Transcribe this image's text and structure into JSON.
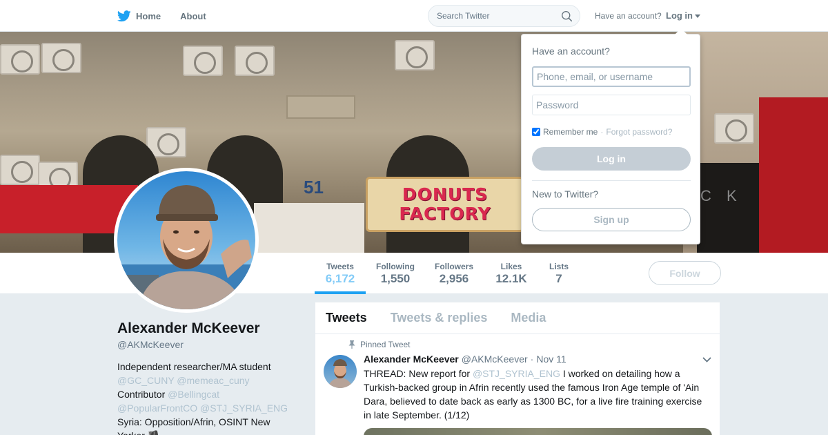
{
  "nav": {
    "home_label": "Home",
    "about_label": "About",
    "search_placeholder": "Search Twitter",
    "have_account": "Have an account?",
    "login_label": "Log in",
    "brand_color": "#1da1f2"
  },
  "banner": {
    "sign_donuts": "DONUTS",
    "sign_factory": "FACTORY",
    "sign_number": "51",
    "sign_letters": "C K"
  },
  "profile": {
    "name": "Alexander McKeever",
    "handle": "@AKMcKeever",
    "bio": {
      "line1": "Independent researcher/MA student",
      "line2": "@GC_CUNY @memeac_cuny",
      "line3_prefix": "Contributor",
      "line3_link": "@Bellingcat",
      "line4": "@PopularFrontCO @STJ_SYRIA_ENG",
      "line5": "Syria: Opposition/Afrin, OSINT New",
      "line6": "Yorker 🏴"
    }
  },
  "stats": [
    {
      "label": "Tweets",
      "value": "6,172",
      "active": true
    },
    {
      "label": "Following",
      "value": "1,550"
    },
    {
      "label": "Followers",
      "value": "2,956"
    },
    {
      "label": "Likes",
      "value": "12.1K"
    },
    {
      "label": "Lists",
      "value": "7"
    }
  ],
  "follow_label": "Follow",
  "timeline": {
    "tabs": [
      "Tweets",
      "Tweets & replies",
      "Media"
    ],
    "pinned_label": "Pinned Tweet",
    "tweet": {
      "name": "Alexander McKeever",
      "handle": "@AKMcKeever",
      "time": "Nov 11",
      "text_part1": "THREAD: New report for ",
      "text_link": "@STJ_SYRIA_ENG",
      "text_part2": " I worked on detailing how a Turkish-backed group in Afrin recently used the famous Iron Age temple of 'Ain Dara, believed to date back as early as 1300 BC, for a live fire training exercise in late September. (1/12)"
    }
  },
  "login_dropdown": {
    "title": "Have an account?",
    "username_placeholder": "Phone, email, or username",
    "password_placeholder": "Password",
    "remember_label": "Remember me",
    "remember_checked": true,
    "separator": "·",
    "forgot_label": "Forgot password?",
    "login_button": "Log in",
    "new_label": "New to Twitter?",
    "signup_button": "Sign up"
  }
}
